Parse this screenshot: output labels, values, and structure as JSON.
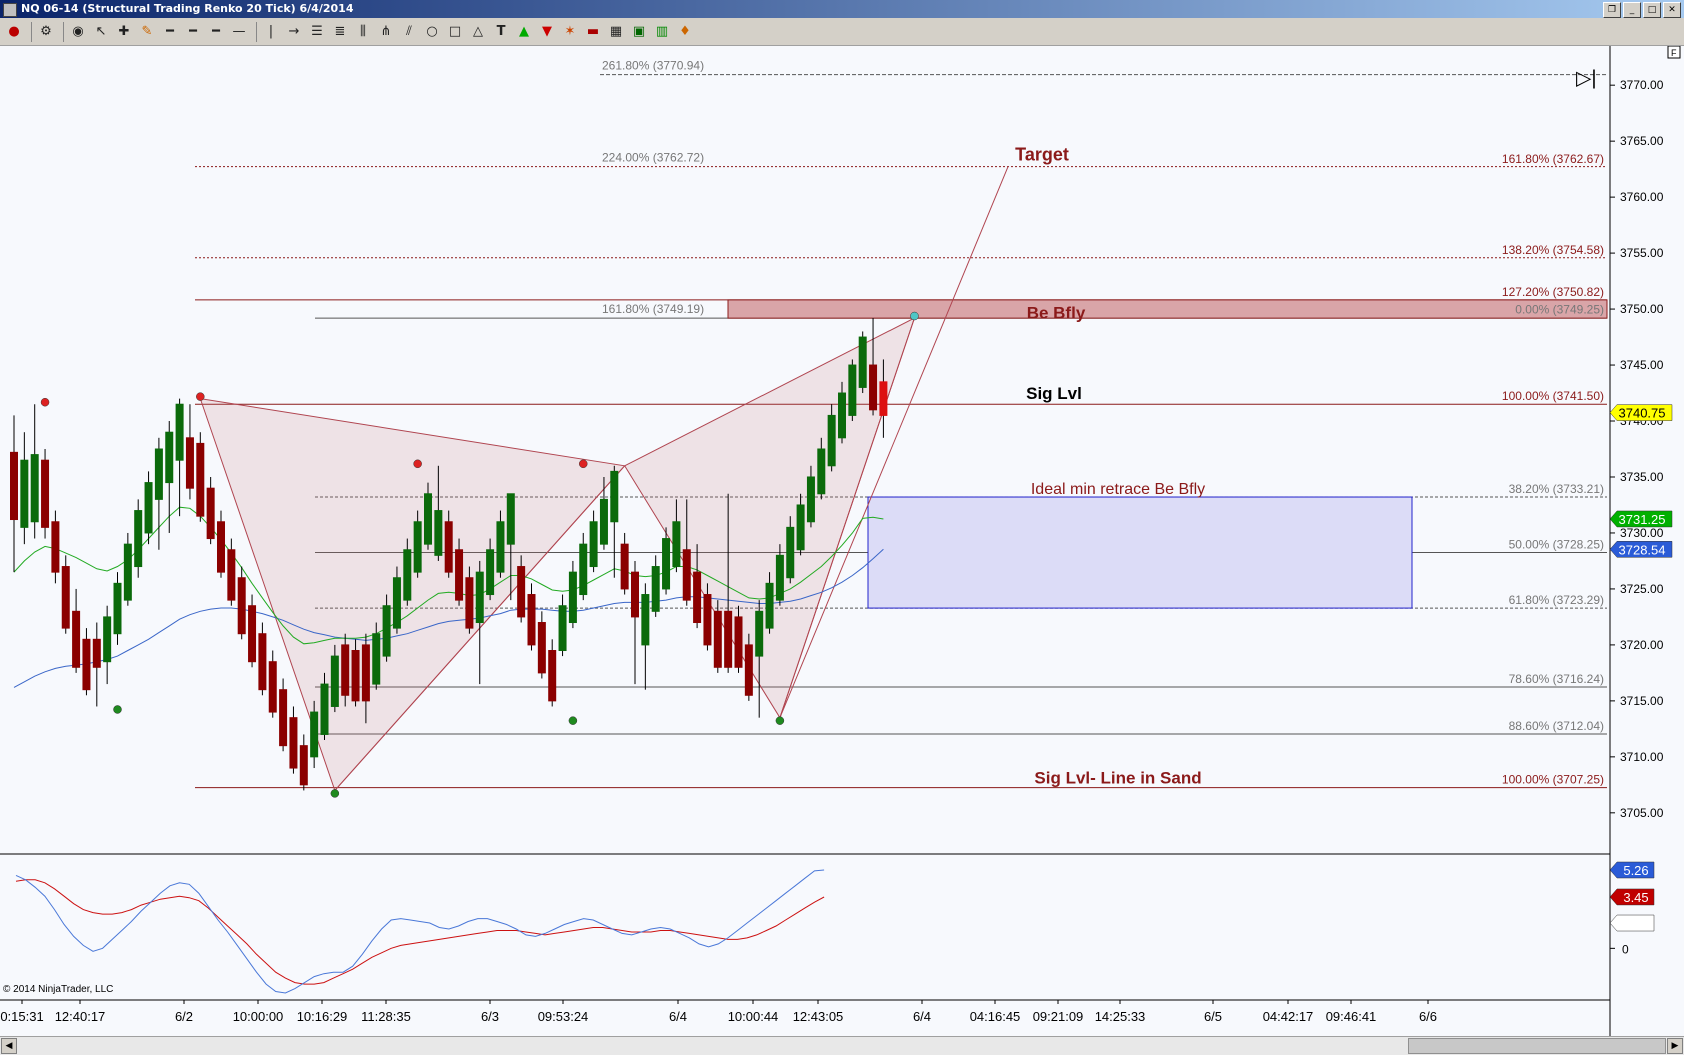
{
  "window": {
    "title": "NQ 06-14 (Structural Trading Renko 20 Tick)  6/4/2014",
    "buttons": [
      "restore-icon",
      "minimize-icon",
      "maximize-icon",
      "close-icon"
    ]
  },
  "toolbar": {
    "icons": [
      "record-icon",
      "instrument-icon",
      "eye-icon",
      "cursor-icon",
      "crosshair-icon",
      "draw-icon",
      "line-style-icon",
      "line-style-2-icon",
      "line-style-3-icon",
      "line-style-4-icon",
      "vertical-line-icon",
      "ray-icon",
      "fib-retrace-icon",
      "fib-ext-icon",
      "fib-time-icon",
      "andrews-icon",
      "regression-icon",
      "ellipse-icon",
      "rectangle-icon",
      "triangle-icon",
      "text-icon",
      "arrow-up-icon",
      "arrow-down-icon",
      "pattern-icon",
      "hide-icon",
      "data-box-icon",
      "chart-trader-icon",
      "bar-type-icon",
      "properties-icon"
    ]
  },
  "chart_data": {
    "type": "candlestick",
    "y_axis": {
      "ticks": [
        3705,
        3710,
        3715,
        3720,
        3725,
        3730,
        3735,
        3740,
        3745,
        3750,
        3755,
        3760,
        3765,
        3770
      ],
      "tick_labels": [
        "3705.00",
        "3710.00",
        "3715.00",
        "3720.00",
        "3725.00",
        "3730.00",
        "3735.00",
        "3740.00",
        "3745.00",
        "3750.00",
        "3755.00",
        "3760.00",
        "3765.00",
        "3770.00"
      ],
      "range": [
        3701.5,
        3773.5
      ]
    },
    "x_axis": {
      "tick_labels": [
        "0:15:31",
        "12:40:17",
        "6/2",
        "10:00:00",
        "10:16:29",
        "11:28:35",
        "6/3",
        "09:53:24",
        "6/4",
        "10:00:44",
        "12:43:05",
        "6/4",
        "04:16:45",
        "09:21:09",
        "14:25:33",
        "6/5",
        "04:42:17",
        "09:46:41",
        "6/6"
      ]
    },
    "candles": [
      {
        "o": 3737.2,
        "c": 3731.2,
        "h": 3740.5,
        "l": 3726.5
      },
      {
        "o": 3730.5,
        "c": 3736.5,
        "h": 3739,
        "l": 3729
      },
      {
        "o": 3731,
        "c": 3737,
        "h": 3741.5,
        "l": 3729.5
      },
      {
        "o": 3736.5,
        "c": 3730.5,
        "h": 3737.5,
        "l": 3729.5
      },
      {
        "o": 3731,
        "c": 3726.5,
        "h": 3732,
        "l": 3725.5
      },
      {
        "o": 3727,
        "c": 3721.5,
        "h": 3728,
        "l": 3721
      },
      {
        "o": 3723,
        "c": 3718,
        "h": 3725,
        "l": 3717.5
      },
      {
        "o": 3720.5,
        "c": 3716,
        "h": 3721.5,
        "l": 3715.5
      },
      {
        "o": 3720.5,
        "c": 3718,
        "h": 3722,
        "l": 3714.5
      },
      {
        "o": 3718.5,
        "c": 3722.5,
        "h": 3723.5,
        "l": 3716.5
      },
      {
        "o": 3721,
        "c": 3725.5,
        "h": 3726.5,
        "l": 3720
      },
      {
        "o": 3724,
        "c": 3729,
        "h": 3730,
        "l": 3723.5
      },
      {
        "o": 3727,
        "c": 3732,
        "h": 3733,
        "l": 3726
      },
      {
        "o": 3730,
        "c": 3734.5,
        "h": 3735.5,
        "l": 3729
      },
      {
        "o": 3733,
        "c": 3737.5,
        "h": 3738.5,
        "l": 3728.5
      },
      {
        "o": 3734.5,
        "c": 3739,
        "h": 3740,
        "l": 3730
      },
      {
        "o": 3736.5,
        "c": 3741.5,
        "h": 3742,
        "l": 3731.5
      },
      {
        "o": 3738.5,
        "c": 3734,
        "h": 3741.5,
        "l": 3733
      },
      {
        "o": 3738,
        "c": 3731.5,
        "h": 3739,
        "l": 3731
      },
      {
        "o": 3734,
        "c": 3729.5,
        "h": 3735,
        "l": 3729
      },
      {
        "o": 3731,
        "c": 3726.5,
        "h": 3732,
        "l": 3726
      },
      {
        "o": 3728.5,
        "c": 3724,
        "h": 3729.5,
        "l": 3723.5
      },
      {
        "o": 3726,
        "c": 3721,
        "h": 3727,
        "l": 3720.5
      },
      {
        "o": 3723.5,
        "c": 3718.5,
        "h": 3724.5,
        "l": 3718
      },
      {
        "o": 3721,
        "c": 3716,
        "h": 3722,
        "l": 3715.5
      },
      {
        "o": 3718.5,
        "c": 3714,
        "h": 3719.5,
        "l": 3713.5
      },
      {
        "o": 3716,
        "c": 3711,
        "h": 3717,
        "l": 3710.5
      },
      {
        "o": 3713.5,
        "c": 3709,
        "h": 3714.5,
        "l": 3708.5
      },
      {
        "o": 3711,
        "c": 3707.5,
        "h": 3712,
        "l": 3707
      },
      {
        "o": 3710,
        "c": 3714,
        "h": 3715,
        "l": 3709
      },
      {
        "o": 3712,
        "c": 3716.5,
        "h": 3717.5,
        "l": 3711.5
      },
      {
        "o": 3714.5,
        "c": 3719,
        "h": 3720,
        "l": 3714
      },
      {
        "o": 3720,
        "c": 3715.5,
        "h": 3721,
        "l": 3714.5
      },
      {
        "o": 3719.5,
        "c": 3715,
        "h": 3720.5,
        "l": 3714.5
      },
      {
        "o": 3720,
        "c": 3715,
        "h": 3721,
        "l": 3713
      },
      {
        "o": 3716.5,
        "c": 3721,
        "h": 3722,
        "l": 3716
      },
      {
        "o": 3719,
        "c": 3723.5,
        "h": 3724.5,
        "l": 3718.5
      },
      {
        "o": 3721.5,
        "c": 3726,
        "h": 3727,
        "l": 3721
      },
      {
        "o": 3724,
        "c": 3728.5,
        "h": 3729.5,
        "l": 3723.5
      },
      {
        "o": 3726.5,
        "c": 3731,
        "h": 3732,
        "l": 3726
      },
      {
        "o": 3729,
        "c": 3733.5,
        "h": 3734.5,
        "l": 3728.5
      },
      {
        "o": 3728,
        "c": 3732,
        "h": 3736,
        "l": 3727.5
      },
      {
        "o": 3731,
        "c": 3726.5,
        "h": 3732,
        "l": 3726
      },
      {
        "o": 3728.5,
        "c": 3724,
        "h": 3729.5,
        "l": 3723.5
      },
      {
        "o": 3726,
        "c": 3721.5,
        "h": 3727,
        "l": 3721
      },
      {
        "o": 3722,
        "c": 3726.5,
        "h": 3727.5,
        "l": 3716.5
      },
      {
        "o": 3724.5,
        "c": 3728.5,
        "h": 3729.5,
        "l": 3724
      },
      {
        "o": 3726.5,
        "c": 3731,
        "h": 3732,
        "l": 3726
      },
      {
        "o": 3729,
        "c": 3733.5,
        "h": 3733.5,
        "l": 3724
      },
      {
        "o": 3727,
        "c": 3722.5,
        "h": 3728,
        "l": 3722
      },
      {
        "o": 3724.5,
        "c": 3720,
        "h": 3725.5,
        "l": 3719.5
      },
      {
        "o": 3722,
        "c": 3717.5,
        "h": 3723,
        "l": 3717
      },
      {
        "o": 3719.5,
        "c": 3715,
        "h": 3720.5,
        "l": 3714.5
      },
      {
        "o": 3719.5,
        "c": 3723.5,
        "h": 3724.5,
        "l": 3719
      },
      {
        "o": 3722,
        "c": 3726.5,
        "h": 3727.5,
        "l": 3721.5
      },
      {
        "o": 3724.5,
        "c": 3729,
        "h": 3730,
        "l": 3724
      },
      {
        "o": 3727,
        "c": 3731,
        "h": 3732,
        "l": 3726.5
      },
      {
        "o": 3729,
        "c": 3733,
        "h": 3735,
        "l": 3728.5
      },
      {
        "o": 3731,
        "c": 3735.5,
        "h": 3736,
        "l": 3726
      },
      {
        "o": 3729,
        "c": 3725,
        "h": 3730,
        "l": 3724.5
      },
      {
        "o": 3726.5,
        "c": 3722.5,
        "h": 3727.5,
        "l": 3716.5
      },
      {
        "o": 3720,
        "c": 3724.5,
        "h": 3725.5,
        "l": 3716
      },
      {
        "o": 3723,
        "c": 3727,
        "h": 3728,
        "l": 3722.5
      },
      {
        "o": 3725,
        "c": 3729.5,
        "h": 3730.5,
        "l": 3724.5
      },
      {
        "o": 3727,
        "c": 3731,
        "h": 3733,
        "l": 3726.5
      },
      {
        "o": 3728.5,
        "c": 3724,
        "h": 3733,
        "l": 3723.5
      },
      {
        "o": 3726.5,
        "c": 3722,
        "h": 3729,
        "l": 3721.5
      },
      {
        "o": 3724.5,
        "c": 3720,
        "h": 3725.5,
        "l": 3719.5
      },
      {
        "o": 3723,
        "c": 3718,
        "h": 3724,
        "l": 3717.5
      },
      {
        "o": 3723,
        "c": 3718,
        "h": 3733.5,
        "l": 3717.5
      },
      {
        "o": 3722.5,
        "c": 3718,
        "h": 3723.5,
        "l": 3717.5
      },
      {
        "o": 3720,
        "c": 3715.5,
        "h": 3721,
        "l": 3715
      },
      {
        "o": 3719,
        "c": 3723,
        "h": 3724,
        "l": 3713.5
      },
      {
        "o": 3721.5,
        "c": 3725.5,
        "h": 3726.5,
        "l": 3721
      },
      {
        "o": 3724,
        "c": 3728,
        "h": 3729,
        "l": 3723.5
      },
      {
        "o": 3726,
        "c": 3730.5,
        "h": 3731.5,
        "l": 3725.5
      },
      {
        "o": 3728.5,
        "c": 3732.5,
        "h": 3733.5,
        "l": 3728
      },
      {
        "o": 3731,
        "c": 3735,
        "h": 3736,
        "l": 3730.5
      },
      {
        "o": 3733.5,
        "c": 3737.5,
        "h": 3738.5,
        "l": 3733
      },
      {
        "o": 3736,
        "c": 3740.5,
        "h": 3741.5,
        "l": 3735.5
      },
      {
        "o": 3738.5,
        "c": 3742.5,
        "h": 3743.5,
        "l": 3738
      },
      {
        "o": 3740.5,
        "c": 3745,
        "h": 3745.5,
        "l": 3740
      },
      {
        "o": 3743,
        "c": 3747.5,
        "h": 3748,
        "l": 3742.5
      },
      {
        "o": 3745,
        "c": 3741,
        "h": 3749.2,
        "l": 3740.5
      },
      {
        "o": 3743.5,
        "c": 3740.5,
        "h": 3745.5,
        "l": 3738.5
      }
    ],
    "swing_highs": [
      {
        "bar": 3,
        "price": 3741.5
      },
      {
        "bar": 18,
        "price": 3742
      },
      {
        "bar": 39,
        "price": 3736
      },
      {
        "bar": 55,
        "price": 3736
      },
      {
        "bar": 87,
        "price": 3749.2
      }
    ],
    "swing_lows": [
      {
        "bar": 10,
        "price": 3714.5
      },
      {
        "bar": 31,
        "price": 3707
      },
      {
        "bar": 54,
        "price": 3713.5
      },
      {
        "bar": 74,
        "price": 3713.5
      }
    ],
    "harmonic_pattern": {
      "name": "Be Bfly",
      "points": [
        {
          "bar": 18,
          "price": 3742
        },
        {
          "bar": 31,
          "price": 3707
        },
        {
          "bar": 59,
          "price": 3736
        },
        {
          "bar": 74,
          "price": 3713.5
        },
        {
          "bar": 87,
          "price": 3749.2
        }
      ],
      "target_price": 3762.72
    },
    "fib_levels_left": [
      {
        "label": "261.80% (3770.94)",
        "price": 3770.94
      },
      {
        "label": "224.00% (3762.72)",
        "price": 3762.72
      },
      {
        "label": "161.80% (3749.19)",
        "price": 3749.19
      }
    ],
    "fib_levels_right": [
      {
        "label": "161.80% (3762.67)",
        "price": 3762.67
      },
      {
        "label": "138.20% (3754.58)",
        "price": 3754.58
      },
      {
        "label": "127.20% (3750.82)",
        "price": 3750.82
      },
      {
        "label": "0.00% (3749.25)",
        "price": 3749.25
      },
      {
        "label": "100.00% (3741.50)",
        "price": 3741.5
      },
      {
        "label": "38.20% (3733.21)",
        "price": 3733.21
      },
      {
        "label": "50.00% (3728.25)",
        "price": 3728.25
      },
      {
        "label": "61.80% (3723.29)",
        "price": 3723.29
      },
      {
        "label": "78.60% (3716.24)",
        "price": 3716.24
      },
      {
        "label": "88.60% (3712.04)",
        "price": 3712.04
      },
      {
        "label": "100.00% (3707.25)",
        "price": 3707.25
      }
    ],
    "annotations": {
      "target": "Target",
      "be_bfly": "Be Bfly",
      "sig_lvl": "Sig Lvl",
      "ideal_retrace": "Ideal min retrace Be Bfly",
      "line_in_sand": "Sig Lvl- Line in Sand"
    },
    "price_markers": [
      {
        "label": "3740.75",
        "price": 3740.75,
        "color": "#ffff00",
        "text_color": "#000000"
      },
      {
        "label": "3731.25",
        "price": 3731.25,
        "color": "#00b000",
        "text_color": "#ffffff"
      },
      {
        "label": "3728.54",
        "price": 3728.54,
        "color": "#2a5bd7",
        "text_color": "#ffffff"
      }
    ],
    "ema_fast": [
      3726.5,
      3727.5,
      3728.3,
      3728.8,
      3728.6,
      3728.2,
      3727.8,
      3727.3,
      3726.8,
      3726.6,
      3727,
      3727.6,
      3728.5,
      3729.5,
      3730.5,
      3731.5,
      3732.3,
      3732.2,
      3731.5,
      3730.5,
      3729.4,
      3728.2,
      3726.9,
      3725.5,
      3724.2,
      3722.9,
      3721.7,
      3720.7,
      3720.1,
      3720.2,
      3720.4,
      3720.6,
      3720.6,
      3720.6,
      3720.7,
      3721,
      3721.5,
      3722,
      3722.6,
      3723.3,
      3724,
      3724.6,
      3724.7,
      3724.6,
      3724.4,
      3724.5,
      3725,
      3725.6,
      3726.2,
      3726.2,
      3725.9,
      3725.4,
      3724.9,
      3724.8,
      3724.9,
      3725.3,
      3725.8,
      3726.3,
      3726.8,
      3726.6,
      3726.2,
      3726.1,
      3726.2,
      3726.5,
      3727,
      3727,
      3726.7,
      3726.2,
      3725.7,
      3725.2,
      3724.7,
      3724.2,
      3724.1,
      3724.2,
      3724.6,
      3725,
      3725.6,
      3726.3,
      3727,
      3727.9,
      3728.9,
      3730,
      3731.3,
      3731.4,
      3731.25
    ],
    "ema_slow": [
      3716.2,
      3716.7,
      3717.2,
      3717.6,
      3717.9,
      3718.1,
      3718.2,
      3718.3,
      3718.5,
      3718.7,
      3719,
      3719.5,
      3720,
      3720.5,
      3721.1,
      3721.7,
      3722.3,
      3722.7,
      3723,
      3723.2,
      3723.3,
      3723.3,
      3723.2,
      3723,
      3722.8,
      3722.5,
      3722.2,
      3721.8,
      3721.4,
      3721.1,
      3720.9,
      3720.7,
      3720.6,
      3720.5,
      3720.4,
      3720.5,
      3720.6,
      3720.8,
      3721,
      3721.3,
      3721.6,
      3721.9,
      3722.1,
      3722.2,
      3722.3,
      3722.4,
      3722.6,
      3722.8,
      3723.1,
      3723.2,
      3723.2,
      3723.2,
      3723.1,
      3723,
      3723,
      3723.1,
      3723.3,
      3723.5,
      3723.7,
      3723.8,
      3723.8,
      3723.8,
      3723.9,
      3724,
      3724.2,
      3724.3,
      3724.3,
      3724.2,
      3724.1,
      3724,
      3723.9,
      3723.8,
      3723.7,
      3723.7,
      3723.8,
      3723.9,
      3724.1,
      3724.4,
      3724.7,
      3725.1,
      3725.6,
      3726.2,
      3726.9,
      3727.7,
      3728.54
    ],
    "oscillator": {
      "markers": [
        {
          "label": "5.26",
          "value": 5.26,
          "color": "#2a5bd7"
        },
        {
          "label": "3.45",
          "value": 3.45,
          "color": "#c00000"
        },
        {
          "label": "",
          "value": 1.7,
          "color": "#ffffff"
        }
      ],
      "zero_label": "0",
      "range": [
        -3.2,
        6.2
      ]
    },
    "copyright": "© 2014 NinjaTrader, LLC"
  }
}
